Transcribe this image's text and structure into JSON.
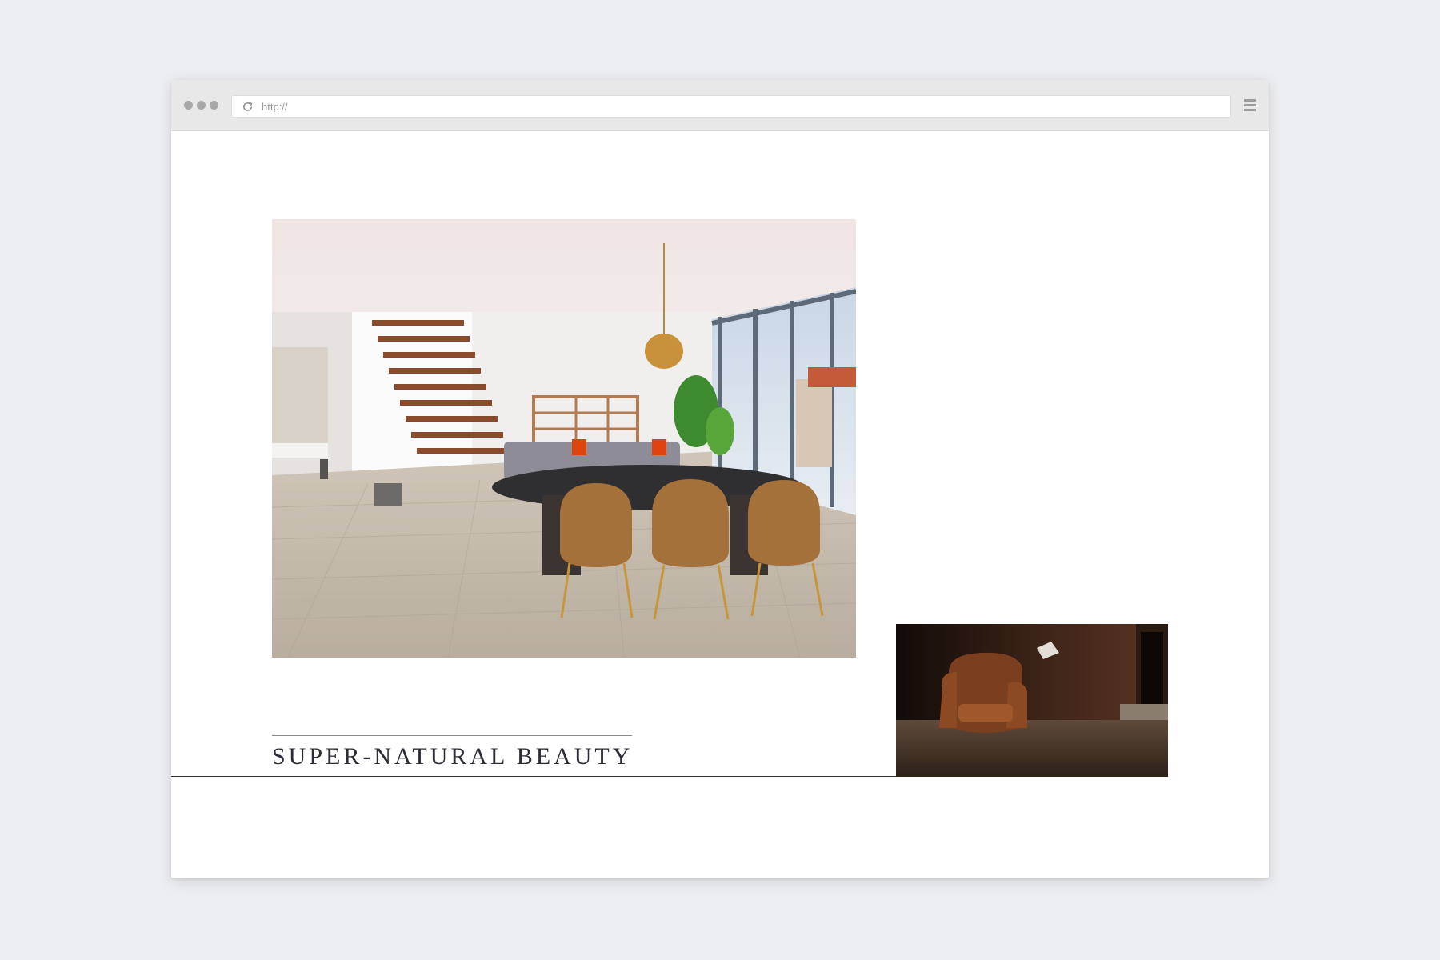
{
  "browser": {
    "url_placeholder": "http://",
    "icons": {
      "window_controls": "three-dots-icon",
      "reload": "reload-icon",
      "menu": "hamburger-menu-icon"
    },
    "colors": {
      "chrome": "#e8e8e8",
      "page_background": "#edeef2",
      "title_text": "#2b2c35"
    }
  },
  "page": {
    "title": "SUPER-NATURAL BEAUTY",
    "hero_image": "dining-room-with-wood-floor-image",
    "secondary_image": "leather-armchair-by-fireplace-image"
  }
}
